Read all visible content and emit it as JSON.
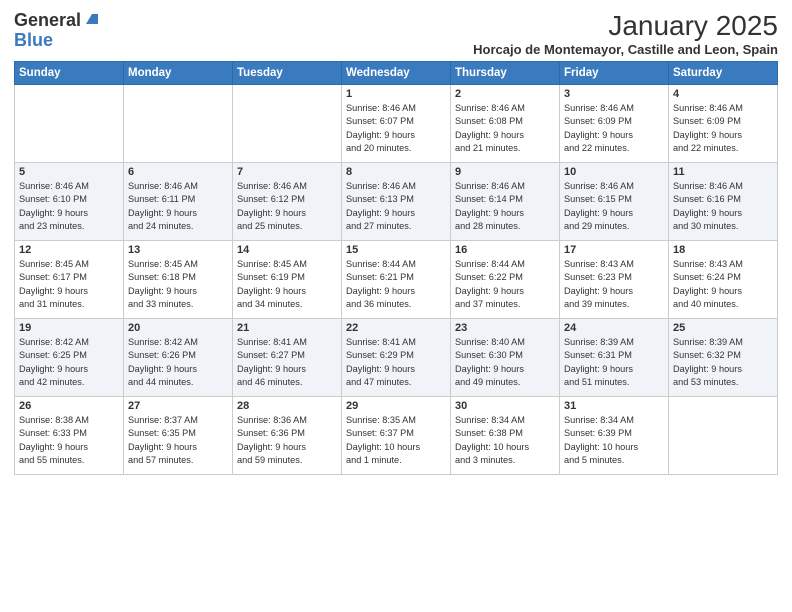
{
  "logo": {
    "general": "General",
    "blue": "Blue"
  },
  "title": "January 2025",
  "subtitle": "Horcajo de Montemayor, Castille and Leon, Spain",
  "headers": [
    "Sunday",
    "Monday",
    "Tuesday",
    "Wednesday",
    "Thursday",
    "Friday",
    "Saturday"
  ],
  "weeks": [
    [
      {
        "day": "",
        "info": ""
      },
      {
        "day": "",
        "info": ""
      },
      {
        "day": "",
        "info": ""
      },
      {
        "day": "1",
        "info": "Sunrise: 8:46 AM\nSunset: 6:07 PM\nDaylight: 9 hours\nand 20 minutes."
      },
      {
        "day": "2",
        "info": "Sunrise: 8:46 AM\nSunset: 6:08 PM\nDaylight: 9 hours\nand 21 minutes."
      },
      {
        "day": "3",
        "info": "Sunrise: 8:46 AM\nSunset: 6:09 PM\nDaylight: 9 hours\nand 22 minutes."
      },
      {
        "day": "4",
        "info": "Sunrise: 8:46 AM\nSunset: 6:09 PM\nDaylight: 9 hours\nand 22 minutes."
      }
    ],
    [
      {
        "day": "5",
        "info": "Sunrise: 8:46 AM\nSunset: 6:10 PM\nDaylight: 9 hours\nand 23 minutes."
      },
      {
        "day": "6",
        "info": "Sunrise: 8:46 AM\nSunset: 6:11 PM\nDaylight: 9 hours\nand 24 minutes."
      },
      {
        "day": "7",
        "info": "Sunrise: 8:46 AM\nSunset: 6:12 PM\nDaylight: 9 hours\nand 25 minutes."
      },
      {
        "day": "8",
        "info": "Sunrise: 8:46 AM\nSunset: 6:13 PM\nDaylight: 9 hours\nand 27 minutes."
      },
      {
        "day": "9",
        "info": "Sunrise: 8:46 AM\nSunset: 6:14 PM\nDaylight: 9 hours\nand 28 minutes."
      },
      {
        "day": "10",
        "info": "Sunrise: 8:46 AM\nSunset: 6:15 PM\nDaylight: 9 hours\nand 29 minutes."
      },
      {
        "day": "11",
        "info": "Sunrise: 8:46 AM\nSunset: 6:16 PM\nDaylight: 9 hours\nand 30 minutes."
      }
    ],
    [
      {
        "day": "12",
        "info": "Sunrise: 8:45 AM\nSunset: 6:17 PM\nDaylight: 9 hours\nand 31 minutes."
      },
      {
        "day": "13",
        "info": "Sunrise: 8:45 AM\nSunset: 6:18 PM\nDaylight: 9 hours\nand 33 minutes."
      },
      {
        "day": "14",
        "info": "Sunrise: 8:45 AM\nSunset: 6:19 PM\nDaylight: 9 hours\nand 34 minutes."
      },
      {
        "day": "15",
        "info": "Sunrise: 8:44 AM\nSunset: 6:21 PM\nDaylight: 9 hours\nand 36 minutes."
      },
      {
        "day": "16",
        "info": "Sunrise: 8:44 AM\nSunset: 6:22 PM\nDaylight: 9 hours\nand 37 minutes."
      },
      {
        "day": "17",
        "info": "Sunrise: 8:43 AM\nSunset: 6:23 PM\nDaylight: 9 hours\nand 39 minutes."
      },
      {
        "day": "18",
        "info": "Sunrise: 8:43 AM\nSunset: 6:24 PM\nDaylight: 9 hours\nand 40 minutes."
      }
    ],
    [
      {
        "day": "19",
        "info": "Sunrise: 8:42 AM\nSunset: 6:25 PM\nDaylight: 9 hours\nand 42 minutes."
      },
      {
        "day": "20",
        "info": "Sunrise: 8:42 AM\nSunset: 6:26 PM\nDaylight: 9 hours\nand 44 minutes."
      },
      {
        "day": "21",
        "info": "Sunrise: 8:41 AM\nSunset: 6:27 PM\nDaylight: 9 hours\nand 46 minutes."
      },
      {
        "day": "22",
        "info": "Sunrise: 8:41 AM\nSunset: 6:29 PM\nDaylight: 9 hours\nand 47 minutes."
      },
      {
        "day": "23",
        "info": "Sunrise: 8:40 AM\nSunset: 6:30 PM\nDaylight: 9 hours\nand 49 minutes."
      },
      {
        "day": "24",
        "info": "Sunrise: 8:39 AM\nSunset: 6:31 PM\nDaylight: 9 hours\nand 51 minutes."
      },
      {
        "day": "25",
        "info": "Sunrise: 8:39 AM\nSunset: 6:32 PM\nDaylight: 9 hours\nand 53 minutes."
      }
    ],
    [
      {
        "day": "26",
        "info": "Sunrise: 8:38 AM\nSunset: 6:33 PM\nDaylight: 9 hours\nand 55 minutes."
      },
      {
        "day": "27",
        "info": "Sunrise: 8:37 AM\nSunset: 6:35 PM\nDaylight: 9 hours\nand 57 minutes."
      },
      {
        "day": "28",
        "info": "Sunrise: 8:36 AM\nSunset: 6:36 PM\nDaylight: 9 hours\nand 59 minutes."
      },
      {
        "day": "29",
        "info": "Sunrise: 8:35 AM\nSunset: 6:37 PM\nDaylight: 10 hours\nand 1 minute."
      },
      {
        "day": "30",
        "info": "Sunrise: 8:34 AM\nSunset: 6:38 PM\nDaylight: 10 hours\nand 3 minutes."
      },
      {
        "day": "31",
        "info": "Sunrise: 8:34 AM\nSunset: 6:39 PM\nDaylight: 10 hours\nand 5 minutes."
      },
      {
        "day": "",
        "info": ""
      }
    ]
  ]
}
